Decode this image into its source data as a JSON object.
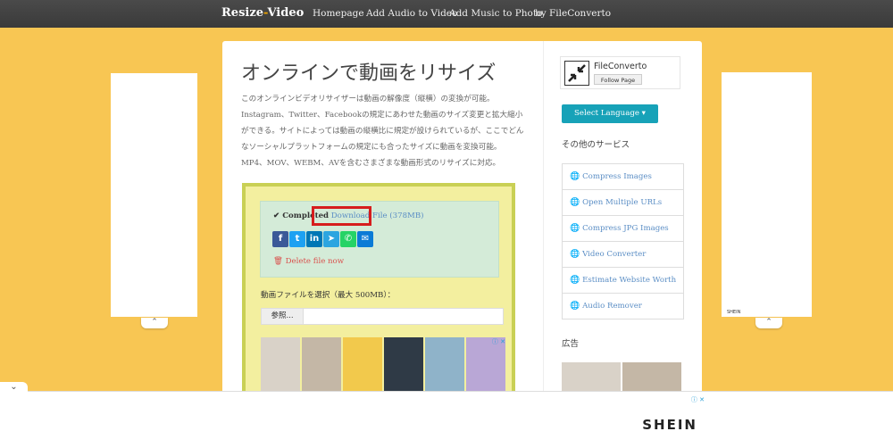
{
  "brand": {
    "name_a": "Resize",
    "dash": "-",
    "name_b": "Video"
  },
  "nav": [
    "Homepage",
    "Add Audio to Video",
    "Add Music to Photo",
    "by FileConverto"
  ],
  "main": {
    "title": "オンラインで動画をリサイズ",
    "intro": "このオンラインビデオリサイザーは動画の解像度（縦横）の変換が可能。Instagram、Twitter、Facebookの規定にあわせた動画のサイズ変更と拡大縮小ができる。サイトによっては動画の縦横比に規定が設けられているが、ここでどんなソーシャルプラットフォームの規定にも合ったサイズに動画を変換可能。MP4、MOV、WEBM、AVを含むさまざまな動画形式のリサイズに対応。",
    "completed": "✔ Completed",
    "download_link": "Download File (378MB)",
    "delete": "🗑 Delete file now",
    "file_label": "動画ファイルを選択（最大 500MB）：",
    "browse": "参照..."
  },
  "share": [
    {
      "name": "facebook",
      "glyph": "f",
      "color": "#3b5998"
    },
    {
      "name": "twitter",
      "glyph": "t",
      "color": "#1da1f2"
    },
    {
      "name": "linkedin",
      "glyph": "in",
      "color": "#0077b5"
    },
    {
      "name": "telegram",
      "glyph": "➤",
      "color": "#2ca5e0"
    },
    {
      "name": "whatsapp",
      "glyph": "✆",
      "color": "#25d366"
    },
    {
      "name": "email",
      "glyph": "✉",
      "color": "#0b7bd6"
    }
  ],
  "sidebar": {
    "fb_name": "FileConverto",
    "fb_follow": "Follow Page",
    "lang_button": "Select Language ▾",
    "services_heading": "その他のサービス",
    "services": [
      "Compress Images",
      "Open Multiple URLs",
      "Compress JPG Images",
      "Video Converter",
      "Estimate Website Worth",
      "Audio Remover"
    ],
    "ad_heading": "広告"
  },
  "ads": {
    "shein": "SHEIN",
    "shein_small": "SHEIN",
    "choice": "ⓘ ✕",
    "colors": [
      "#d9d2c8",
      "#c4b7a6",
      "#f2c94c",
      "#2f3a46",
      "#8fb3c9",
      "#b9a7d6"
    ]
  }
}
